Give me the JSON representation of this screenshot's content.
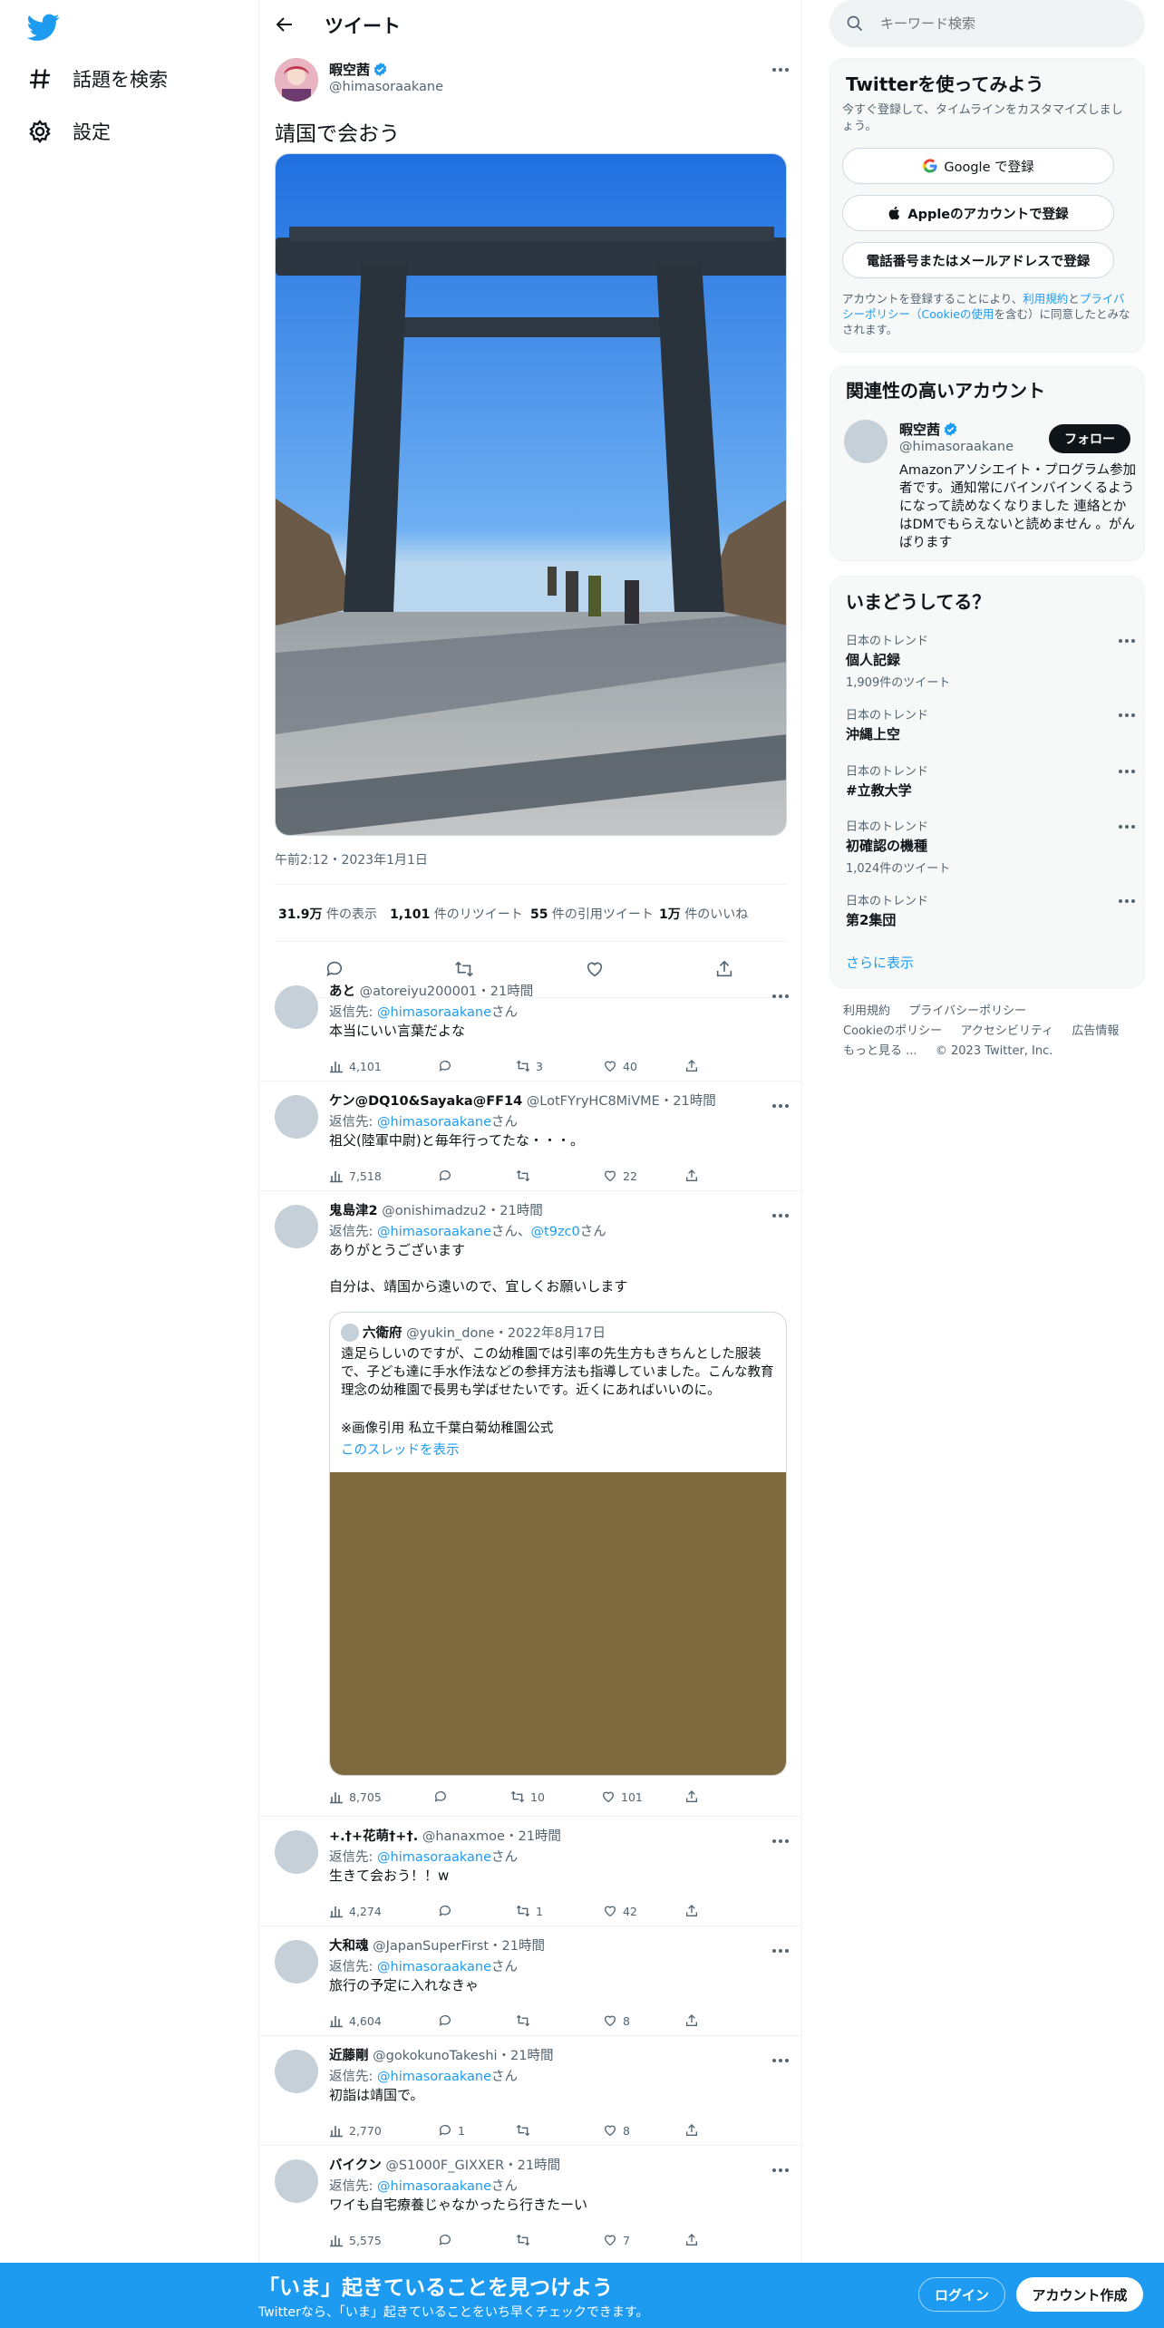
{
  "nav": {
    "explore": "話題を検索",
    "settings": "設定"
  },
  "header": {
    "title": "ツイート"
  },
  "tweet": {
    "author_name": "暇空茜",
    "author_handle": "@himasoraakane",
    "text": "靖国で会おう",
    "timestamp": "午前2:12・2023年1月1日",
    "views_num": "31.9万",
    "views_label": " 件の表示",
    "retweets_num": "1,101",
    "retweets_label": " 件のリツイート",
    "quotes_num": "55",
    "quotes_label": " 件の引用ツイート",
    "likes_num": "1万",
    "likes_label": " 件のいいね"
  },
  "replies": [
    {
      "name": "あと",
      "handle": "@atoreiyu200001",
      "time": "・21時間",
      "reply_prefix": "返信先: ",
      "reply_to": "@himasoraakane",
      "reply_suffix": "さん",
      "text": "本当にいい言葉だよな",
      "views": "4,101",
      "replies": "",
      "retweets": "3",
      "likes": "40"
    },
    {
      "name": "ケン@DQ10&Sayaka@FF14",
      "handle": "@LotFYryHC8MiVME",
      "time": "・21時間",
      "reply_prefix": "返信先: ",
      "reply_to": "@himasoraakane",
      "reply_suffix": "さん",
      "text": "祖父(陸軍中尉)と毎年行ってたな・・・。",
      "views": "7,518",
      "replies": "",
      "retweets": "",
      "likes": "22"
    },
    {
      "name": "鬼島津2",
      "handle": "@onishimadzu2",
      "time": "・21時間",
      "reply_prefix": "返信先: ",
      "reply_to": "@himasoraakane",
      "reply_mid": "さん、",
      "reply_to2": "@t9zc0",
      "reply_suffix": "さん",
      "text_line1": "ありがとうございます",
      "text_line2": "自分は、靖国から遠いので、宜しくお願いします",
      "views": "8,705",
      "replies": "",
      "retweets": "10",
      "likes": "101"
    },
    {
      "name": "+.†+花萌†+†.",
      "handle": "@hanaxmoe",
      "time": "・21時間",
      "reply_prefix": "返信先: ",
      "reply_to": "@himasoraakane",
      "reply_suffix": "さん",
      "text": "生きて会おう！！w",
      "views": "4,274",
      "replies": "",
      "retweets": "1",
      "likes": "42"
    },
    {
      "name": "大和魂",
      "handle": "@JapanSuperFirst",
      "time": "・21時間",
      "reply_prefix": "返信先: ",
      "reply_to": "@himasoraakane",
      "reply_suffix": "さん",
      "text": "旅行の予定に入れなきゃ",
      "views": "4,604",
      "replies": "",
      "retweets": "",
      "likes": "8"
    },
    {
      "name": "近藤剛",
      "handle": "@gokokunoTakeshi",
      "time": "・21時間",
      "reply_prefix": "返信先: ",
      "reply_to": "@himasoraakane",
      "reply_suffix": "さん",
      "text": "初詣は靖国で。",
      "views": "2,770",
      "replies": "1",
      "retweets": "",
      "likes": "8"
    },
    {
      "name": "バイクン",
      "handle": "@S1000F_GIXXER",
      "time": "・21時間",
      "reply_prefix": "返信先: ",
      "reply_to": "@himasoraakane",
      "reply_suffix": "さん",
      "text": "ワイも自宅療養じゃなかったら行きたーい",
      "views": "5,575",
      "replies": "",
      "retweets": "",
      "likes": "7"
    }
  ],
  "quote": {
    "name": "六衛府",
    "handle": "@yukin_done",
    "time": "・2022年8月17日",
    "text": "遠足らしいのですが、この幼稚園では引率の先生方もきちんとした服装で、子ども達に手水作法などの参拝方法も指導していました。こんな教育理念の幼稚園で長男も学ばせたいです。近くにあればいいのに。",
    "note": "※画像引用  私立千葉白菊幼稚園公式",
    "thread_link": "このスレッドを表示"
  },
  "search": {
    "placeholder": "キーワード検索"
  },
  "signup": {
    "title": "Twitterを使ってみよう",
    "subtitle": "今すぐ登録して、タイムラインをカスタマイズしましょう。",
    "google": "Google で登録",
    "apple": "Appleのアカウントで登録",
    "phone": "電話番号またはメールアドレスで登録",
    "legal_1": "アカウントを登録することにより、",
    "legal_terms": "利用規約",
    "legal_2": "と",
    "legal_privacy": "プライバシーポリシー（Cookieの使用",
    "legal_3": "を含む）に同意したとみなされます。"
  },
  "related": {
    "title": "関連性の高いアカウント",
    "name": "暇空茜",
    "handle": "@himasoraakane",
    "follow": "フォロー",
    "bio": "Amazonアソシエイト・プログラム参加者です。通知常にバインバインくるようになって読めなくなりました 連絡とかはDMでもらえないと読めません 。がんばります"
  },
  "trends": {
    "title": "いまどうしてる？",
    "items": [
      {
        "category": "日本のトレンド",
        "topic": "個人記録",
        "count": "1,909件のツイート"
      },
      {
        "category": "日本のトレンド",
        "topic": "沖縄上空",
        "count": ""
      },
      {
        "category": "日本のトレンド",
        "topic": "#立教大学",
        "count": ""
      },
      {
        "category": "日本のトレンド",
        "topic": "初確認の機種",
        "count": "1,024件のツイート"
      },
      {
        "category": "日本のトレンド",
        "topic": "第2集団",
        "count": ""
      }
    ],
    "show_more": "さらに表示"
  },
  "footer": {
    "terms": "利用規約",
    "privacy": "プライバシーポリシー",
    "cookie": "Cookieのポリシー",
    "accessibility": "アクセシビリティ",
    "ads": "広告情報",
    "more": "もっと見る ...",
    "copyright": "© 2023 Twitter, Inc."
  },
  "bottom_bar": {
    "headline": "「いま」起きていることを見つけよう",
    "sub": "Twitterなら、「いま」起きていることをいち早くチェックできます。",
    "login": "ログイン",
    "signup": "アカウント作成"
  },
  "colors": {
    "accent": "#1d9bf0",
    "text": "#0f1419",
    "muted": "#536471",
    "quote_image": "#7f6a40"
  }
}
